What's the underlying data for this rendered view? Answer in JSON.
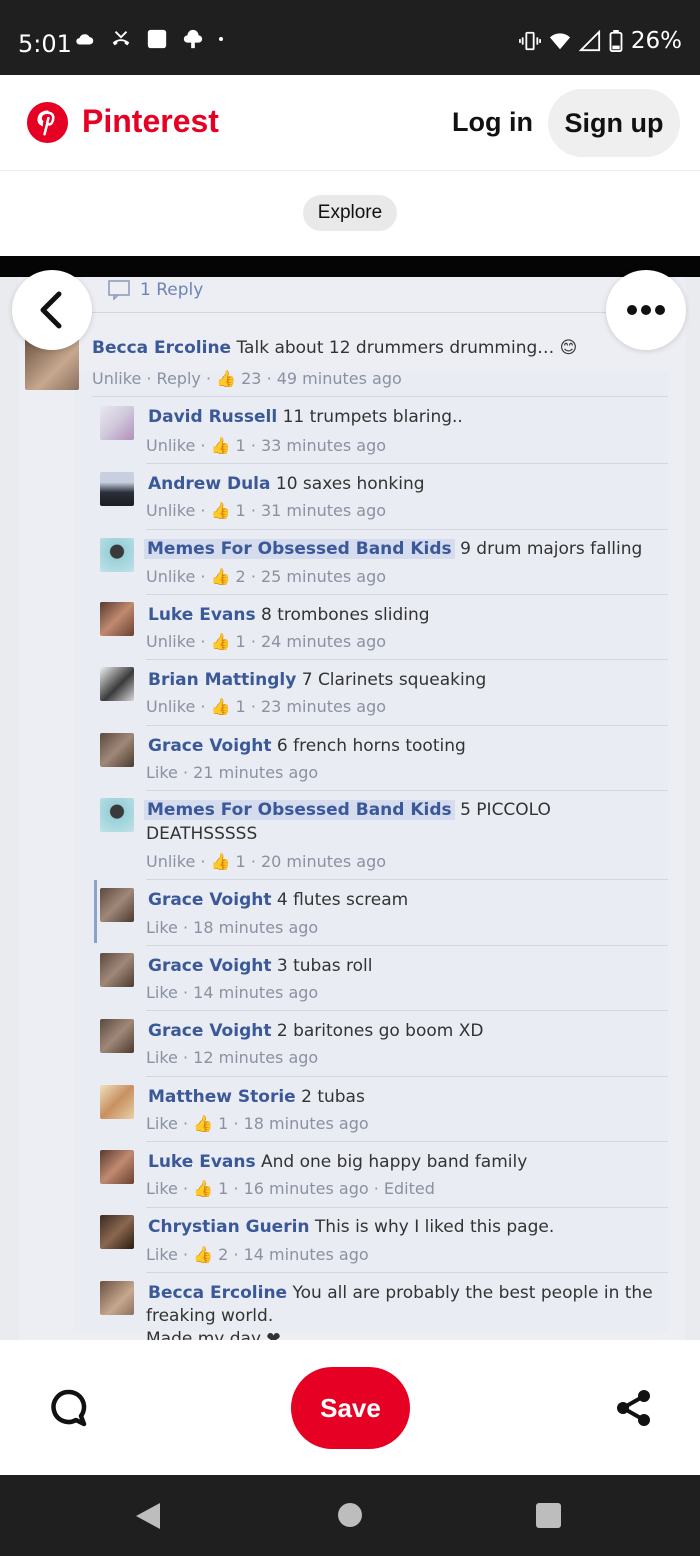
{
  "status_bar": {
    "time": "5:01",
    "battery": "26%",
    "left_icons": [
      "cloud-icon",
      "missed-call-icon",
      "square-notification-icon",
      "cloud-upload-icon",
      "dot-icon"
    ],
    "right_icons": [
      "vibrate-icon",
      "wifi-icon",
      "signal-icon",
      "battery-icon"
    ]
  },
  "header": {
    "brand": "Pinterest",
    "login_label": "Log in",
    "signup_label": "Sign up",
    "brand_color": "#e60023"
  },
  "explore_label": "Explore",
  "pin": {
    "reply_label": "1 Reply",
    "comments": [
      {
        "name": "Becca Ercoline",
        "text": "Talk about 12 drummers drumming… 😊",
        "meta": "Unlike · Reply · 👍 23 · 49 minutes ago"
      },
      {
        "name": "David Russell",
        "text": "11 trumpets blaring..",
        "meta": "Unlike · 👍 1 · 33 minutes ago"
      },
      {
        "name": "Andrew Dula",
        "text": "10 saxes honking",
        "meta": "Unlike · 👍 1 · 31 minutes ago"
      },
      {
        "name": "Memes For Obsessed Band Kids",
        "text": "9 drum majors falling",
        "meta": "Unlike · 👍 2 · 25 minutes ago"
      },
      {
        "name": "Luke Evans",
        "text": "8 trombones sliding",
        "meta": "Unlike · 👍 1 · 24 minutes ago"
      },
      {
        "name": "Brian Mattingly",
        "text": "7 Clarinets squeaking",
        "meta": "Unlike · 👍 1 · 23 minutes ago"
      },
      {
        "name": "Grace Voight",
        "text": "6 french horns tooting",
        "meta": "Like · 21 minutes ago"
      },
      {
        "name": "Memes For Obsessed Band Kids",
        "text": "5 PICCOLO",
        "text2": "DEATHSSSSS",
        "meta": "Unlike · 👍 1 · 20 minutes ago"
      },
      {
        "name": "Grace Voight",
        "text": "4 flutes scream",
        "meta": "Like · 18 minutes ago"
      },
      {
        "name": "Grace Voight",
        "text": "3 tubas roll",
        "meta": "Like · 14 minutes ago"
      },
      {
        "name": "Grace Voight",
        "text": "2 baritones go boom XD",
        "meta": "Like · 12 minutes ago"
      },
      {
        "name": "Matthew Storie",
        "text": "2 tubas",
        "meta": "Like · 👍 1 · 18 minutes ago"
      },
      {
        "name": "Luke Evans",
        "text": "And one big happy band family",
        "meta": "Like · 👍 1 · 16 minutes ago · Edited"
      },
      {
        "name": "Chrystian Guerin",
        "text": "This is why I liked this page.",
        "meta": "Like · 👍 2 · 14 minutes ago"
      },
      {
        "name": "Becca Ercoline",
        "text": "You all are probably the best people in the",
        "text2": "freaking world.",
        "text3": "Made my day ❤"
      }
    ]
  },
  "bottom_bar": {
    "save_label": "Save",
    "icons": [
      "comment-icon",
      "share-icon"
    ]
  },
  "nav_bar": {
    "icons": [
      "back-icon",
      "home-icon",
      "recents-icon"
    ]
  }
}
